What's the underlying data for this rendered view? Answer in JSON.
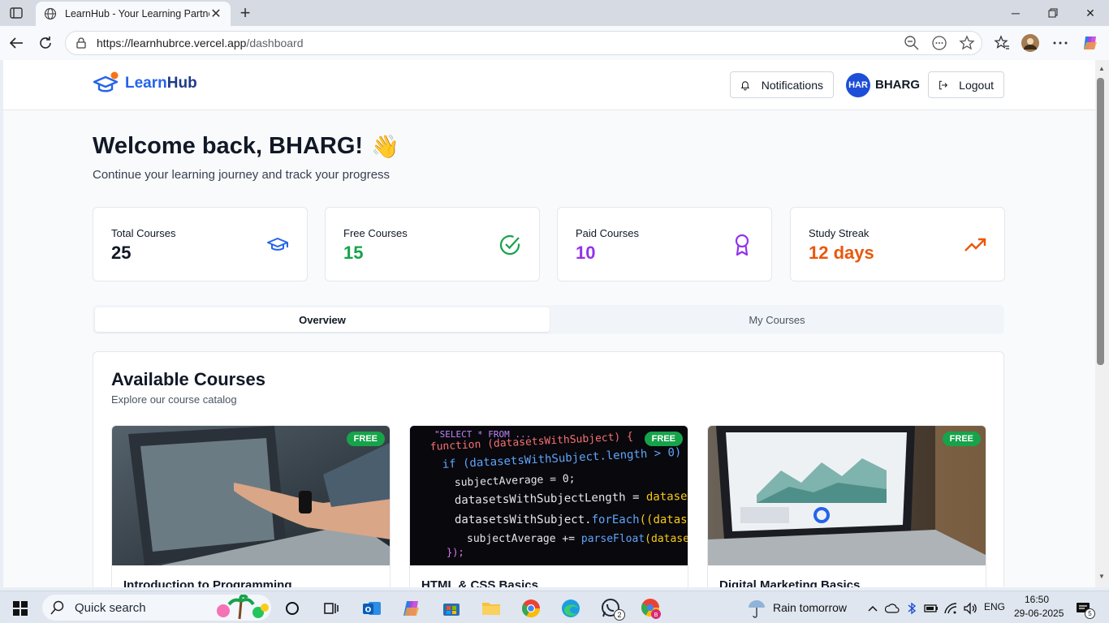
{
  "browser": {
    "tab_title": "LearnHub - Your Learning Partner",
    "url_host": "https://learnhubrce.vercel.app",
    "url_path": "/dashboard"
  },
  "header": {
    "logo_part1": "Learn",
    "logo_part2": "Hub",
    "notifications_label": "Notifications",
    "avatar_text": "HAR",
    "username": "BHARG",
    "logout_label": "Logout"
  },
  "welcome": {
    "title": "Welcome back, BHARG!",
    "emoji": "👋",
    "subtitle": "Continue your learning journey and track your progress"
  },
  "stats": [
    {
      "label": "Total Courses",
      "value": "25",
      "color": "#111827",
      "icon": "graduation-cap-icon"
    },
    {
      "label": "Free Courses",
      "value": "15",
      "color": "#16a34a",
      "icon": "check-circle-icon"
    },
    {
      "label": "Paid Courses",
      "value": "10",
      "color": "#9333ea",
      "icon": "award-icon"
    },
    {
      "label": "Study Streak",
      "value": "12 days",
      "color": "#ea580c",
      "icon": "trending-up-icon"
    }
  ],
  "tabs": {
    "overview": "Overview",
    "my_courses": "My Courses"
  },
  "courses_panel": {
    "title": "Available Courses",
    "subtitle": "Explore our course catalog",
    "courses": [
      {
        "title": "Introduction to Programming",
        "badge": "FREE"
      },
      {
        "title": "HTML & CSS Basics",
        "badge": "FREE"
      },
      {
        "title": "Digital Marketing Basics",
        "badge": "FREE"
      }
    ]
  },
  "taskbar": {
    "search_label": "Quick search",
    "weather": "Rain tomorrow",
    "lang": "ENG",
    "time": "16:50",
    "date": "29-06-2025",
    "whatsapp_count": "2",
    "notif_count": "5"
  }
}
